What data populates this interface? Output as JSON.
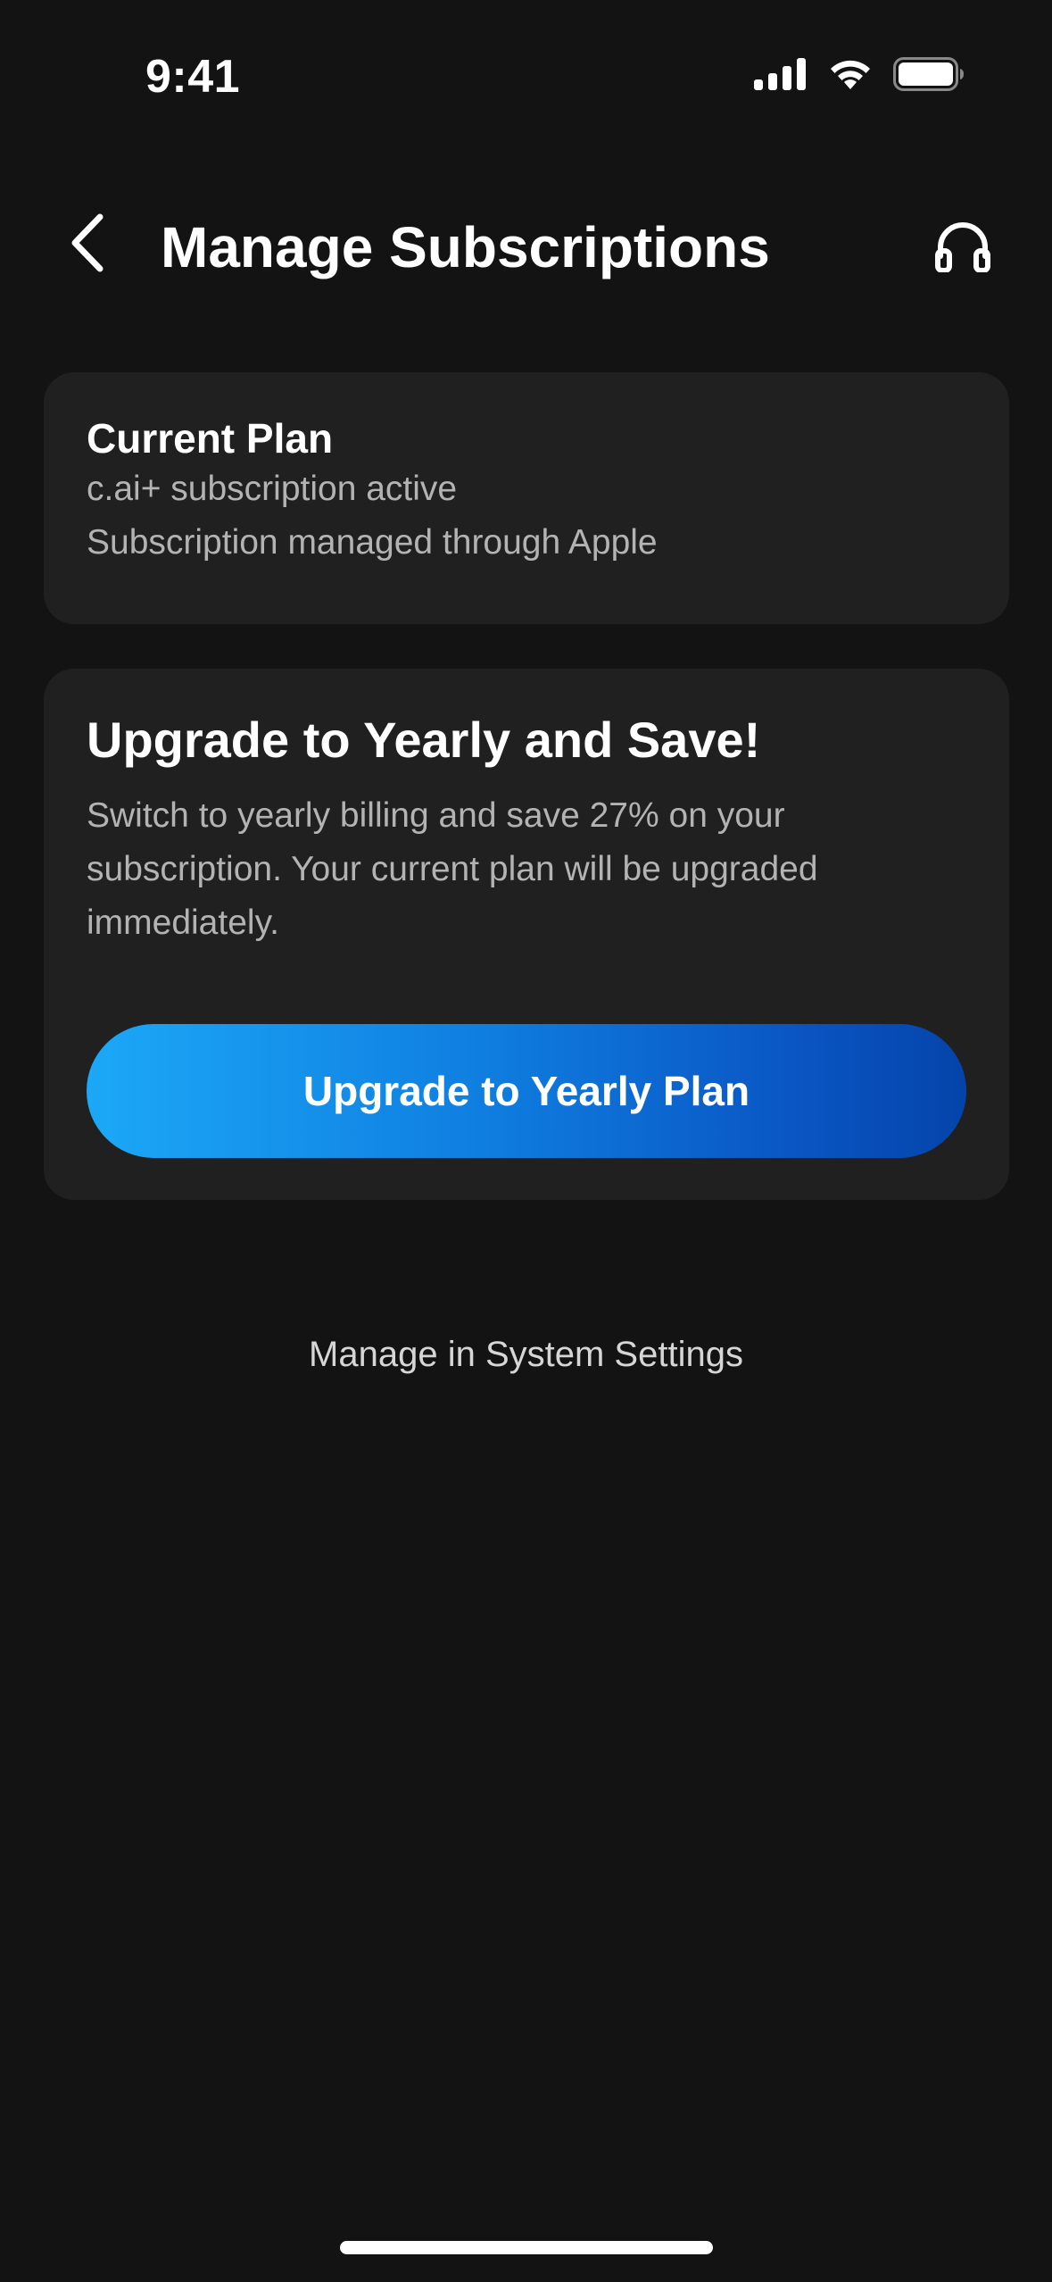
{
  "status_bar": {
    "time": "9:41",
    "icons": [
      "cellular-signal-icon",
      "wifi-icon",
      "battery-icon"
    ]
  },
  "header": {
    "title": "Manage Subscriptions",
    "back_icon": "chevron-left-icon",
    "support_icon": "headphones-icon"
  },
  "current_plan": {
    "title": "Current Plan",
    "status": "c.ai+ subscription active",
    "managed_by": "Subscription managed through Apple"
  },
  "upgrade": {
    "title": "Upgrade to Yearly and Save!",
    "description": "Switch to yearly billing and save 27% on your subscription. Your current plan will be upgraded immediately.",
    "button_label": "Upgrade to Yearly Plan"
  },
  "system_settings_link": "Manage in System Settings",
  "colors": {
    "background": "#131313",
    "card": "#202020",
    "button_gradient_start": "#1ca8f7",
    "button_gradient_end": "#0444aa",
    "secondary_text": "#b3b3b3"
  }
}
